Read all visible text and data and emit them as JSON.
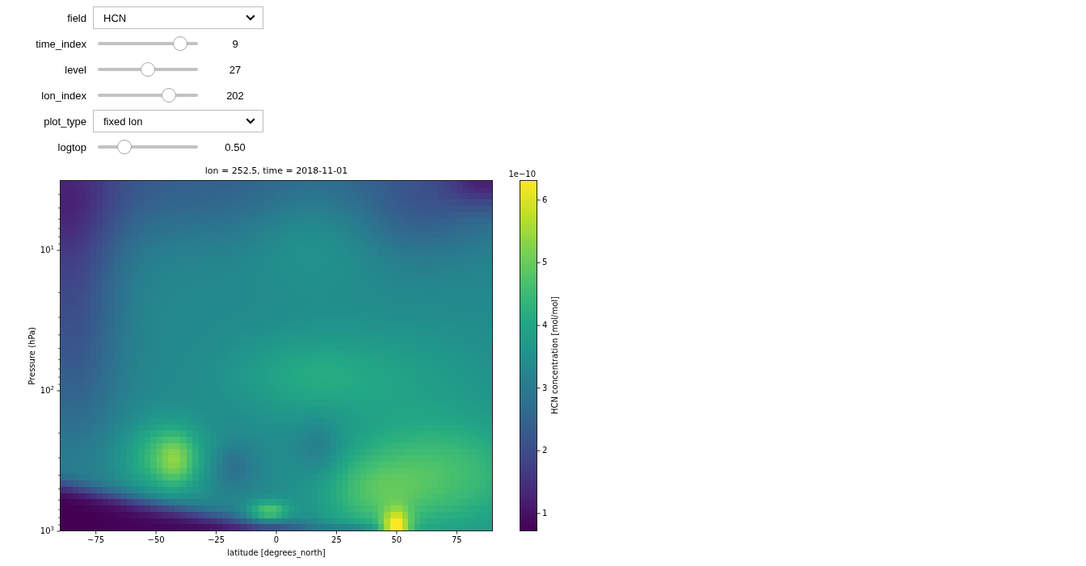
{
  "controls": [
    {
      "kind": "dropdown",
      "label": "field",
      "value": "HCN"
    },
    {
      "kind": "slider",
      "label": "time_index",
      "level": 0.82,
      "reading": "9"
    },
    {
      "kind": "slider",
      "label": "level",
      "level": 0.5,
      "reading": "27"
    },
    {
      "kind": "slider",
      "label": "lon_index",
      "level": 0.71,
      "reading": "202"
    },
    {
      "kind": "dropdown",
      "label": "plot_type",
      "value": "fixed lon"
    },
    {
      "kind": "slider",
      "label": "logtop",
      "level": 0.27,
      "reading": "0.50"
    }
  ],
  "plot": {
    "title": "lon = 252.5, time = 2018-11-01",
    "xlabel": "latitude [degrees_north]",
    "ylabel": "Pressure (hPa)",
    "xticks": [
      "−75",
      "−50",
      "−25",
      "0",
      "25",
      "50",
      "75"
    ],
    "yticks": [
      "10$^{1}$",
      "10$^{2}$",
      "10$^{3}$"
    ],
    "colorbar": {
      "label": "HCN concentration [mol/mol]",
      "offset": "1e−10",
      "ticks": [
        "6",
        "5",
        "4",
        "3",
        "2",
        "1"
      ]
    }
  }
}
